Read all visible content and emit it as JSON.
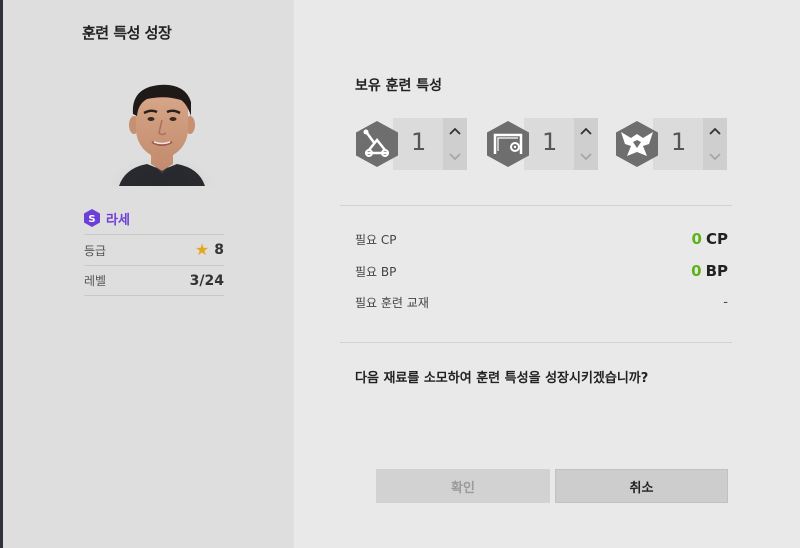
{
  "dialog": {
    "title": "훈련 특성 성장"
  },
  "player": {
    "name": "라세",
    "season_badge": "S",
    "grade_label": "등급",
    "grade_value": "8",
    "level_label": "레벨",
    "level_value": "3/24",
    "season_color": "#6d3fd6"
  },
  "owned": {
    "title": "보유 훈련 특성",
    "traits": [
      {
        "icon": "catapult-icon",
        "count": "1"
      },
      {
        "icon": "goal-net-icon",
        "count": "1"
      },
      {
        "icon": "winged-crest-icon",
        "count": "1"
      }
    ]
  },
  "costs": {
    "cp_label": "필요 CP",
    "cp_value": "0",
    "cp_unit": "CP",
    "bp_label": "필요 BP",
    "bp_value": "0",
    "bp_unit": "BP",
    "material_label": "필요 훈련 교재",
    "material_value": "-",
    "value_color": "#5eb21a"
  },
  "question": "다음 재료를 소모하여 훈련 특성을 성장시키겠습니까?",
  "buttons": {
    "confirm": "확인",
    "cancel": "취소"
  }
}
